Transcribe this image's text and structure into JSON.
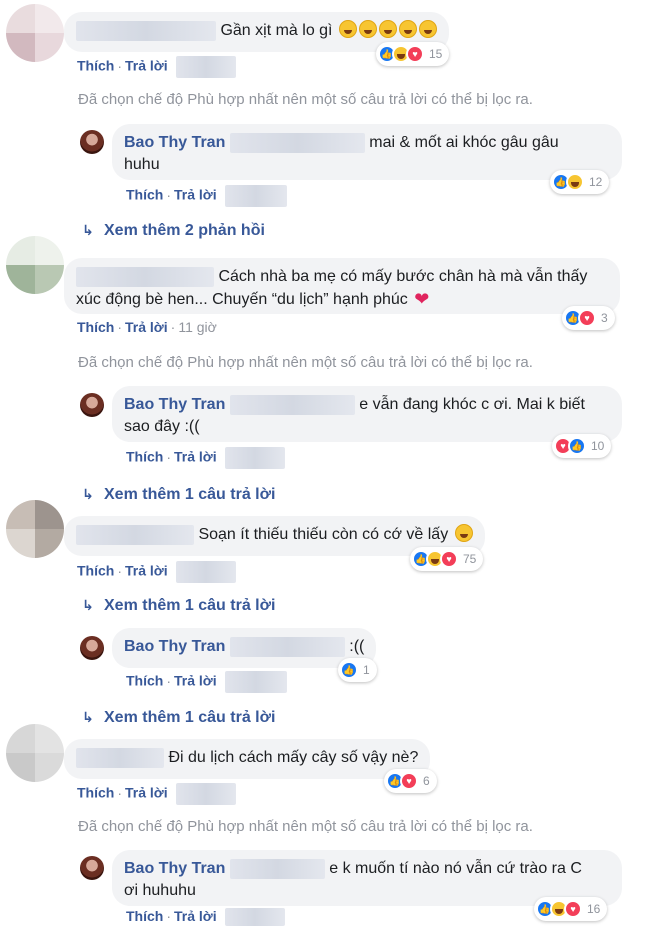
{
  "labels": {
    "like": "Thích",
    "reply": "Trả lời",
    "separator": "·",
    "filter_notice": "Đã chọn chế độ Phù hợp nhất nên một số câu trả lời có thể bị lọc ra.",
    "reply_arrow": "↳"
  },
  "colors": {
    "link_blue": "#385898",
    "bubble_bg": "#f2f3f5",
    "muted": "#90949c",
    "like_blue": "#1877f2",
    "love_red": "#f33e58",
    "haha_yellow": "#f7c531"
  },
  "comments": [
    {
      "text": "Gần xịt mà lo gì",
      "emoji": "rolling-on-floor-laughing-emoji x5",
      "reactions": [
        "like",
        "haha",
        "love"
      ],
      "count": "15"
    },
    {
      "author": "Bao Thy Tran",
      "text": "mai & mốt ai khóc gâu gâu huhu",
      "line1": "mai & mốt ai khóc gâu gâu",
      "line2": "huhu",
      "reactions": [
        "like",
        "haha"
      ],
      "count": "12"
    },
    {
      "more": "Xem thêm 2 phản hồi"
    },
    {
      "line1": "Cách nhà ba mẹ có mấy bước chân hà mà vẫn thấy",
      "line2": "xúc động bè hen... Chuyến “du lịch” hạnh phúc",
      "emoji": "red-heart-emoji",
      "time": "11 giờ",
      "reactions": [
        "like",
        "love"
      ],
      "count": "3"
    },
    {
      "author": "Bao Thy Tran",
      "line1": "e vẫn đang khóc c ơi. Mai k biết",
      "line2": "sao đây :((",
      "reactions": [
        "love",
        "like"
      ],
      "count": "10"
    },
    {
      "more": "Xem thêm 1 câu trả lời"
    },
    {
      "text": "Soạn ít thiếu thiếu còn có cớ về lấy",
      "emoji": "smiling-face-emoji",
      "reactions": [
        "like",
        "haha",
        "love"
      ],
      "count": "75"
    },
    {
      "more": "Xem thêm 1 câu trả lời"
    },
    {
      "author": "Bao Thy Tran",
      "text": ":((",
      "reactions": [
        "like"
      ],
      "count": "1"
    },
    {
      "more": "Xem thêm 1 câu trả lời"
    },
    {
      "text": "Đi du lịch cách mấy cây số vậy nè?",
      "reactions": [
        "like",
        "love"
      ],
      "count": "6"
    },
    {
      "author": "Bao Thy Tran",
      "line1": "e k muốn tí nào nó vẫn cứ trào ra C",
      "line2": "ơi huhuhu",
      "reactions": [
        "like",
        "haha",
        "love"
      ],
      "count": "16"
    }
  ]
}
